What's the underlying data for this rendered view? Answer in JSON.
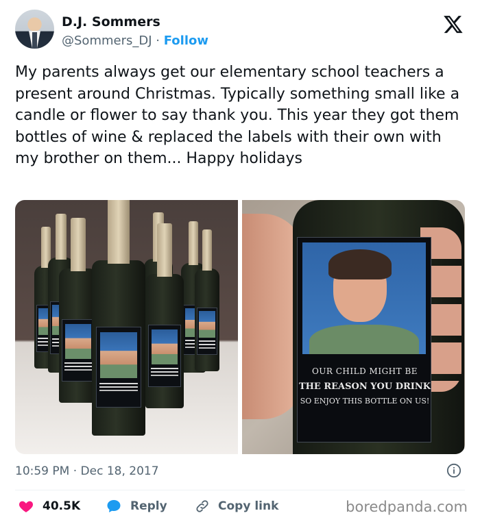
{
  "author": {
    "name": "D.J. Sommers",
    "handle": "@Sommers_DJ",
    "separator": "·",
    "follow_label": "Follow"
  },
  "tweet": {
    "text": "My parents always get our elementary school teachers a present around Christmas. Typically something small like a candle or flower to say thank you. This year they got them bottles of wine & replaced the labels with their own with my brother on them... Happy holidays"
  },
  "bottle_label": {
    "line1": "OUR CHILD MIGHT BE",
    "line2": "THE REASON YOU DRINK",
    "line3": "SO ENJOY THIS BOTTLE ON US!"
  },
  "meta": {
    "timestamp": "10:59 PM · Dec 18, 2017"
  },
  "actions": {
    "likes": "40.5K",
    "reply_label": "Reply",
    "copy_label": "Copy link"
  },
  "watermark": "boredpanda.com",
  "colors": {
    "link_blue": "#1d9bf0",
    "like_red": "#f91880",
    "muted": "#536471"
  }
}
